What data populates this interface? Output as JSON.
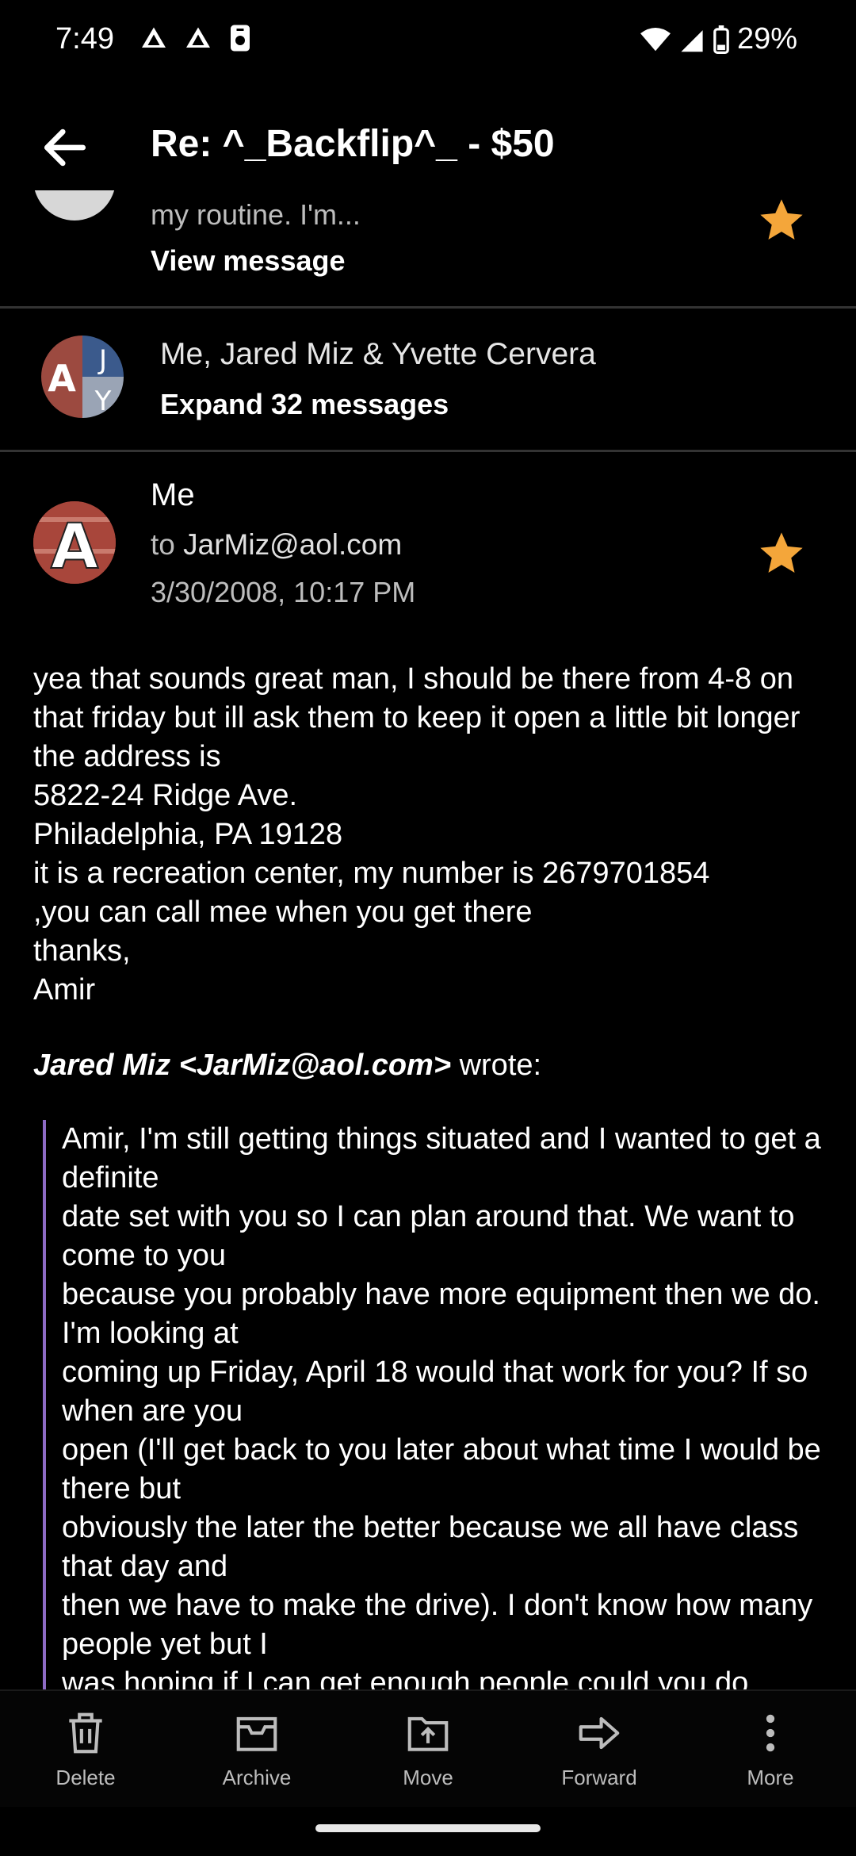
{
  "status_bar": {
    "time": "7:49",
    "battery": "29%"
  },
  "app_bar": {
    "title": "Re: ^_Backflip^_ - $50"
  },
  "collapsed_message": {
    "snippet": "my routine. I'm...",
    "view_label": "View message"
  },
  "thread_group": {
    "participants": "Me, Jared Miz & Yvette Cervera",
    "expand_label": "Expand 32 messages",
    "avatar_letters": [
      "A",
      "J",
      "Y"
    ]
  },
  "message": {
    "sender": "Me",
    "avatar_letter": "A",
    "to_label": "to",
    "to_address": "JarMiz@aol.com",
    "date": "3/30/2008, 10:17 PM",
    "body": "yea that sounds great man, I should be there from 4-8 on that friday but ill ask them to keep it open a little bit longer the address is\n5822-24 Ridge Ave.\nPhiladelphia, PA 19128\nit is a recreation center, my number is 2679701854\n,you can call mee when you get there\nthanks,\nAmir",
    "quote_author": "Jared Miz <JarMiz@aol.com>",
    "quote_suffix": " wrote:",
    "quoted_text": "Amir, I'm still getting things situated and I wanted to get a definite\ndate set with you so I can plan around that. We want to come to you\nbecause you probably have more equipment then we do. I'm looking at\ncoming up Friday, April 18 would that work for you? If so when are you\nopen (I'll get back to you later about what time I would be there but\nobviously the later the better because we all have class that day and\nthen we have to make the drive). I don't know how many people yet but I\nwas hoping if I can get enough people could you do"
  },
  "toolbar": {
    "delete": "Delete",
    "archive": "Archive",
    "move": "Move",
    "forward": "Forward",
    "more": "More"
  },
  "colors": {
    "star": "#F4A63A",
    "quote_bar": "#8D6BC5",
    "background": "#000000"
  }
}
